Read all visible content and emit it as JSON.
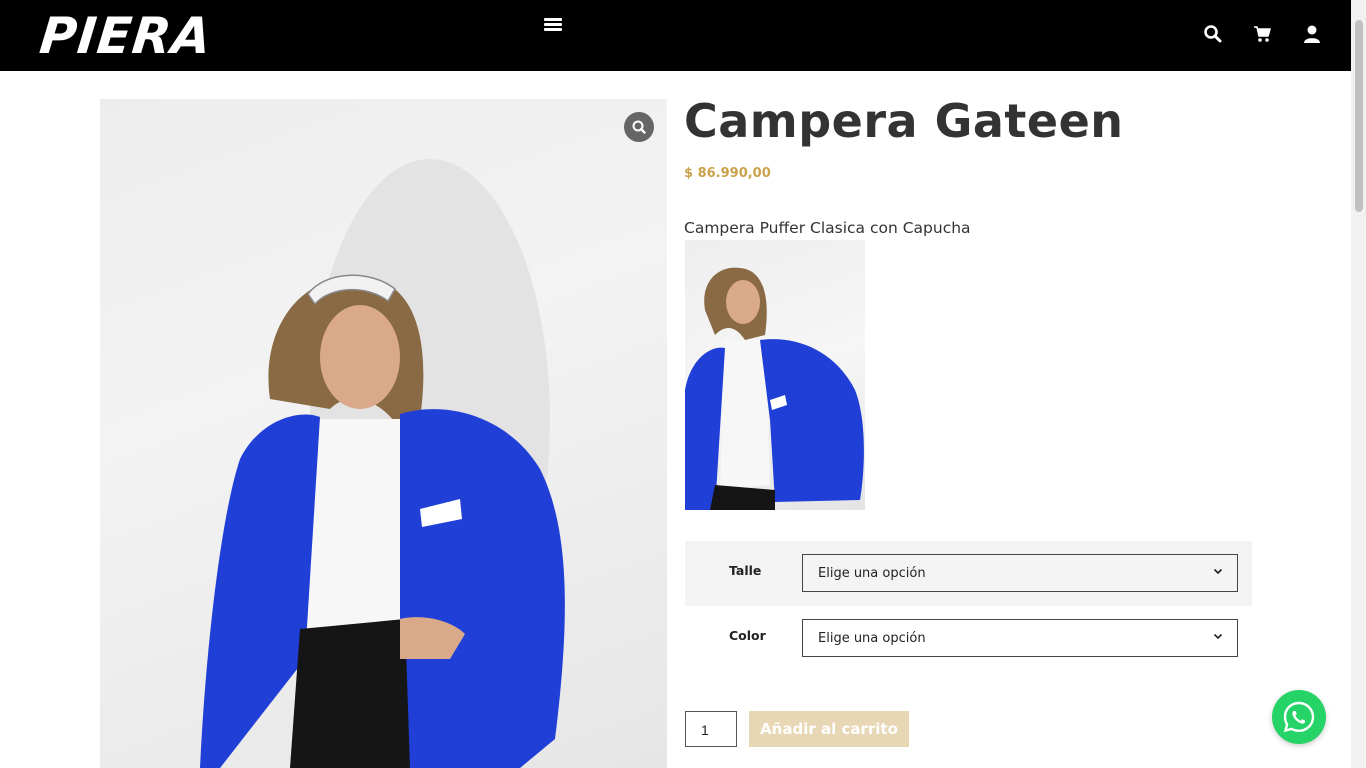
{
  "header": {
    "logo_text": "PIERA",
    "icons": [
      "menu-icon",
      "search-icon",
      "cart-icon",
      "user-icon"
    ]
  },
  "product": {
    "title": "Campera Gateen",
    "price": "$ 86.990,00",
    "description": "Campera Puffer Clasica con Capucha"
  },
  "variations": [
    {
      "label": "Talle",
      "selected": "Elige una opción"
    },
    {
      "label": "Color",
      "selected": "Elige una opción"
    }
  ],
  "cart": {
    "quantity": "1",
    "add_label": "Añadir al carrito"
  },
  "colors": {
    "header_bg": "#000000",
    "price": "#c9a24a",
    "button_disabled": "#e8d7b4",
    "jacket_blue": "#1f3fd6",
    "whatsapp": "#25d366"
  }
}
